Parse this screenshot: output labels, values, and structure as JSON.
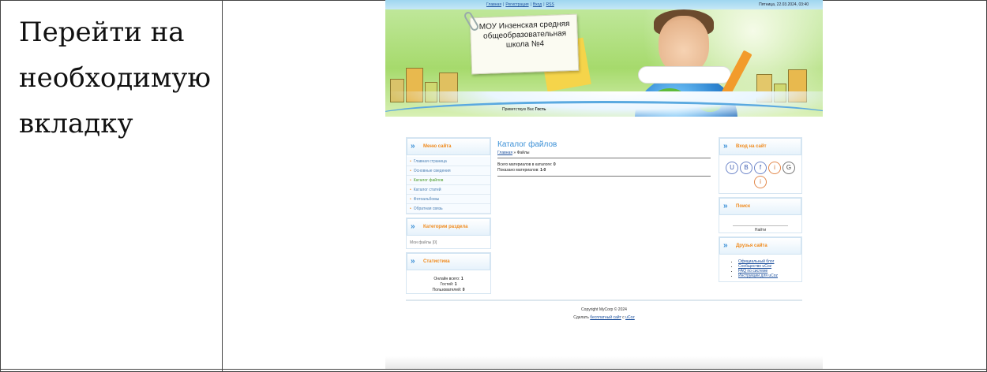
{
  "instruction": {
    "line1": "Перейти на",
    "line2": "необходимую",
    "line3": "вкладку"
  },
  "site": {
    "topnav": [
      "Главная",
      "Регистрация",
      "Вход",
      "RSS"
    ],
    "datetime": "Пятница, 22.03.2024, 03:40",
    "school_title": "МОУ Инзенская средняя общеобразовательная школа №4",
    "greeting_prefix": "Приветствую Вас",
    "greeting_user": "Гость",
    "menu": {
      "title": "Меню сайта",
      "items": [
        "Главная страница",
        "Основные сведения",
        "Каталог файлов",
        "Каталог статей",
        "Фотоальбомы",
        "Обратная связь"
      ],
      "active_index": 2
    },
    "categories": {
      "title": "Категории раздела",
      "items": [
        "Мои файлы [0]"
      ]
    },
    "stats": {
      "title": "Статистика",
      "online_label": "Онлайн всего:",
      "online_value": "1",
      "guests_label": "Гостей:",
      "guests_value": "1",
      "users_label": "Пользователей:",
      "users_value": "0"
    },
    "main": {
      "title": "Каталог файлов",
      "crumb_home": "Главная",
      "crumb_current": "Файлы",
      "total_label": "Всего материалов в каталоге:",
      "total_value": "0",
      "shown_label": "Показано материалов:",
      "shown_value": "1-0"
    },
    "login": {
      "title": "Вход на сайт",
      "buttons": [
        "U",
        "B",
        "f",
        "i",
        "G",
        "i"
      ]
    },
    "search": {
      "title": "Поиск",
      "button": "Найти"
    },
    "friends": {
      "title": "Друзья сайта",
      "links": [
        "Официальный блог",
        "Сообщество uCoz",
        "FAQ по системе",
        "Инструкции для uCoz"
      ]
    },
    "footer": {
      "copyright": "Copyright MyCorp © 2024",
      "made_prefix": "Сделать",
      "made_link1": "бесплатный сайт",
      "made_mid": "с",
      "made_link2": "uCoz"
    },
    "colors": {
      "accent_blue": "#3a8fd6",
      "accent_orange": "#f08a1c",
      "link": "#1b4f9c",
      "header_green": "#a6da6c"
    }
  }
}
